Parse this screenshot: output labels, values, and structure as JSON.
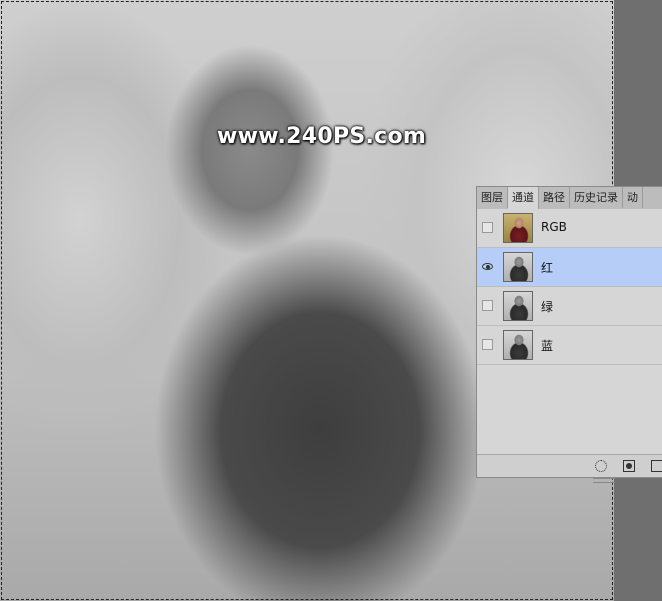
{
  "watermark": {
    "text": "www.240PS.com"
  },
  "channels_panel": {
    "tabs": [
      {
        "label": "图层",
        "active": false
      },
      {
        "label": "通道",
        "active": true
      },
      {
        "label": "路径",
        "active": false
      },
      {
        "label": "历史记录",
        "active": false
      },
      {
        "label": "动",
        "active": false
      }
    ],
    "channels": [
      {
        "name": "RGB",
        "visible": false,
        "selected": false,
        "thumb": "color"
      },
      {
        "name": "红",
        "visible": true,
        "selected": true,
        "thumb": "gray"
      },
      {
        "name": "绿",
        "visible": false,
        "selected": false,
        "thumb": "gray"
      },
      {
        "name": "蓝",
        "visible": false,
        "selected": false,
        "thumb": "gray"
      }
    ],
    "footer_icons": [
      "load-selection-icon",
      "save-selection-icon",
      "new-channel-icon"
    ]
  },
  "colors": {
    "selected_row": "#b6cdf7",
    "panel_bg": "#d6d6d6",
    "workspace_bg": "#6e6e6e"
  }
}
